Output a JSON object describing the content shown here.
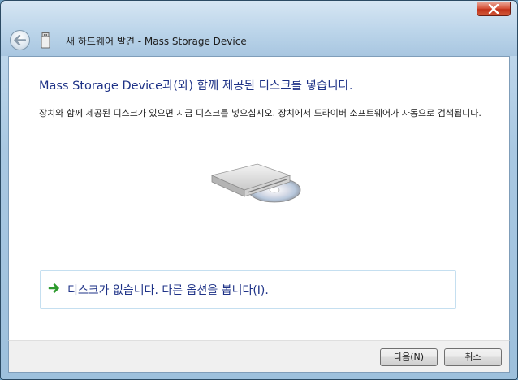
{
  "window": {
    "title": "새 하드웨어 발견 - Mass Storage Device",
    "close_glyph": "✕"
  },
  "content": {
    "heading": "Mass Storage Device과(와) 함께 제공된 디스크를 넣습니다.",
    "instructions": "장치와 함께 제공된 디스크가 있으면 지금 디스크를 넣으십시오. 장치에서 드라이버 소프트웨어가 자동으로 검색됩니다.",
    "option_label": "디스크가 없습니다. 다른 옵션을 봅니다(I)."
  },
  "footer": {
    "next_label": "다음(N)",
    "cancel_label": "취소"
  },
  "icons": {
    "back": "back-arrow-icon",
    "device": "usb-device-icon",
    "drive": "disc-drive-icon",
    "option": "green-arrow-icon",
    "accent_color": "#1e3287",
    "close_color": "#c1321a"
  }
}
